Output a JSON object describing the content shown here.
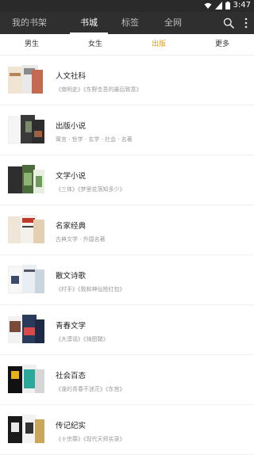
{
  "status": {
    "time": "3:47"
  },
  "topnav": {
    "tabs": [
      {
        "label": "我的书架",
        "active": false
      },
      {
        "label": "书城",
        "active": true
      },
      {
        "label": "标签",
        "active": false
      },
      {
        "label": "全网",
        "active": false
      }
    ],
    "icons": [
      "search-icon",
      "more-vertical-icon"
    ]
  },
  "subtabs": [
    {
      "label": "男生",
      "active": false
    },
    {
      "label": "女生",
      "active": false
    },
    {
      "label": "出版",
      "active": true
    },
    {
      "label": "更多",
      "active": false
    }
  ],
  "colors": {
    "accent": "#e39a1c",
    "topbar": "#2f2f2f",
    "statusbar": "#2a2a2a"
  },
  "categories": [
    {
      "title": "人文社科",
      "subtitle": "《南明史》《东野圭吾的最后致意》"
    },
    {
      "title": "出版小说",
      "subtitle": "寓言 · 哲学 · 玄学 · 社会 · 名著"
    },
    {
      "title": "文学小说",
      "subtitle": "《三体》《梦里花落知多少》"
    },
    {
      "title": "名家经典",
      "subtitle": "古典文学 · 外国名著"
    },
    {
      "title": "散文诗歌",
      "subtitle": "《村手》《我和神仙抢红包》"
    },
    {
      "title": "青春文学",
      "subtitle": "《大漠谣》《骑图鞘》"
    },
    {
      "title": "社会百态",
      "subtitle": "《谁的青春不迷茫》《东宫》"
    },
    {
      "title": "传记纪实",
      "subtitle": "《十宗罪》《现代天师实录》"
    }
  ]
}
